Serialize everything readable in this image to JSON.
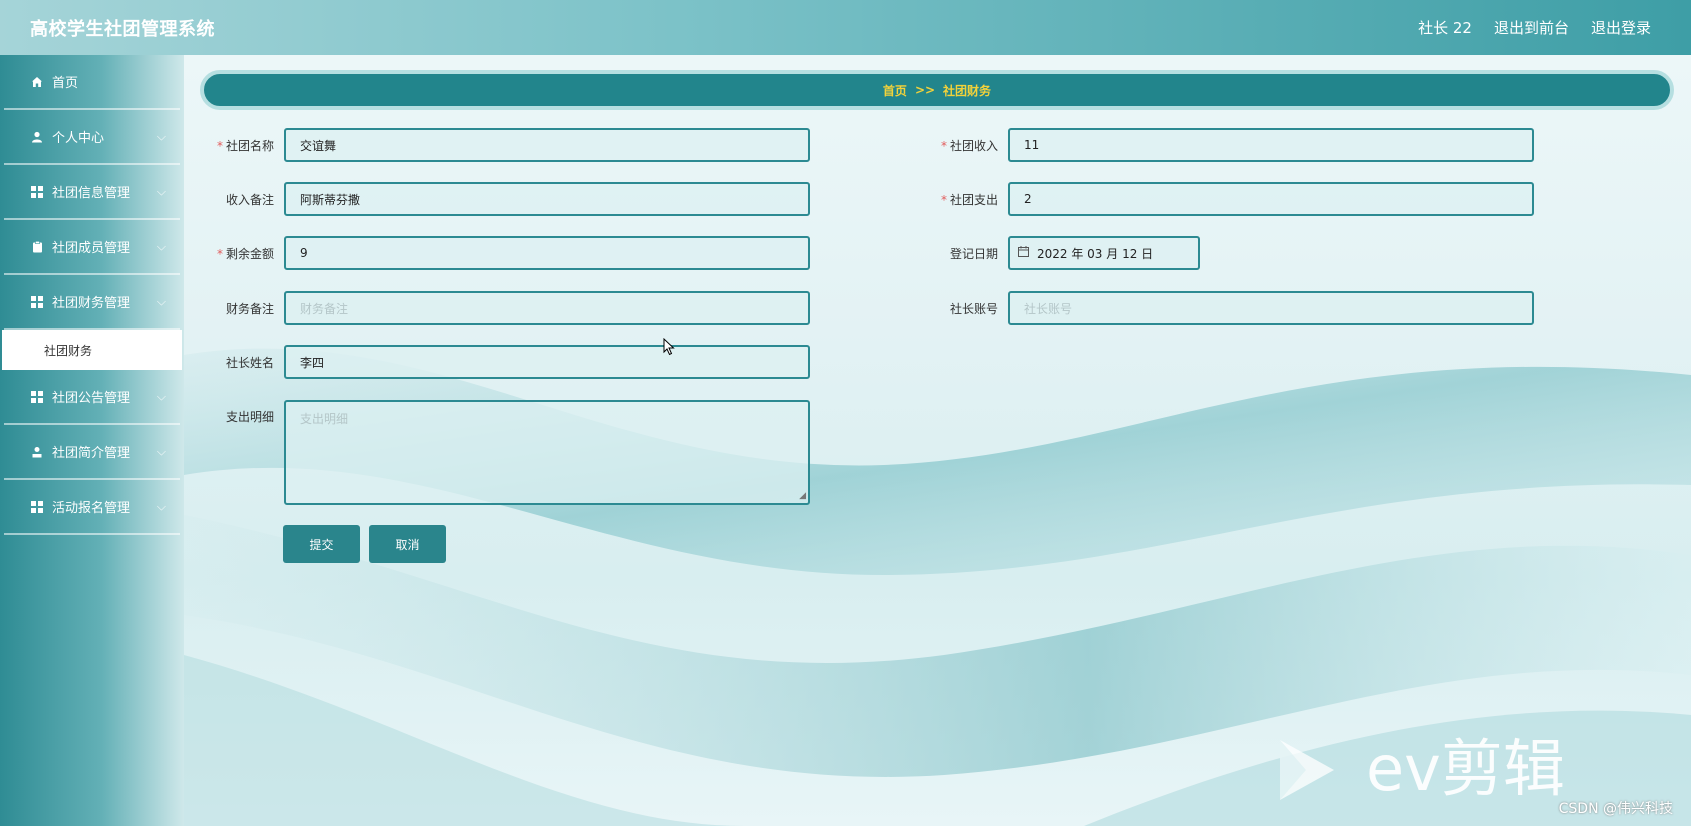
{
  "header": {
    "app_title": "高校学生社团管理系统",
    "user": "社长 22",
    "back_to_front": "退出到前台",
    "logout": "退出登录"
  },
  "sidebar": {
    "items": [
      {
        "label": "首页",
        "icon": "home-icon"
      },
      {
        "label": "个人中心",
        "icon": "user-icon"
      },
      {
        "label": "社团信息管理",
        "icon": "grid-icon"
      },
      {
        "label": "社团成员管理",
        "icon": "clipboard-icon"
      },
      {
        "label": "社团财务管理",
        "icon": "grid-icon"
      },
      {
        "label": "社团公告管理",
        "icon": "grid-icon"
      },
      {
        "label": "社团简介管理",
        "icon": "person-icon"
      },
      {
        "label": "活动报名管理",
        "icon": "grid-icon"
      }
    ],
    "submenu_active": "社团财务"
  },
  "breadcrumb": {
    "home": "首页",
    "sep": ">>",
    "current": "社团财务"
  },
  "form": {
    "club_name": {
      "label": "社团名称",
      "value": "交谊舞",
      "required": true
    },
    "income": {
      "label": "社团收入",
      "value": "11",
      "required": true
    },
    "income_note": {
      "label": "收入备注",
      "value": "阿斯蒂芬撒",
      "required": false
    },
    "expense": {
      "label": "社团支出",
      "value": "2",
      "required": true
    },
    "balance": {
      "label": "剩余金额",
      "value": "9",
      "required": true
    },
    "reg_date": {
      "label": "登记日期",
      "value": "2022 年 03 月 12 日",
      "required": false
    },
    "finance_note": {
      "label": "财务备注",
      "placeholder": "财务备注",
      "required": false
    },
    "president_account": {
      "label": "社长账号",
      "placeholder": "社长账号",
      "required": false
    },
    "president_name": {
      "label": "社长姓名",
      "value": "李四",
      "required": false
    },
    "expense_detail": {
      "label": "支出明细",
      "placeholder": "支出明细",
      "required": false
    },
    "required_mark": "*"
  },
  "buttons": {
    "submit": "提交",
    "cancel": "取消"
  },
  "watermark": {
    "csdn": "CSDN @伟兴科技"
  },
  "colors": {
    "accent": "#22858c",
    "breadcrumb_text": "#f3d23a",
    "required": "#e25c5c"
  }
}
